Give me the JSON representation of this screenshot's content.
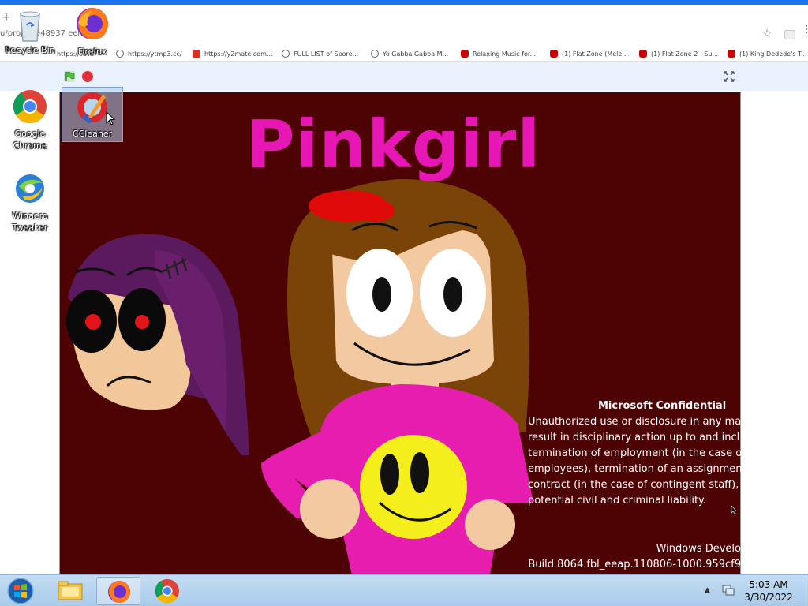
{
  "browser": {
    "new_tab_glyph": "+",
    "url": "u/proj  53948937  een/",
    "bookmarks": [
      {
        "label": "https://sav...",
        "icon": "globe-icon"
      },
      {
        "label": "https://ytmp3.cc/",
        "icon": "globe-icon"
      },
      {
        "label": "https://y2mate.com...",
        "icon": "red-favicon"
      },
      {
        "label": "FULL LIST of Spore...",
        "icon": "globe-icon"
      },
      {
        "label": "Yo Gabba Gabba M...",
        "icon": "globe-icon"
      },
      {
        "label": "Relaxing Music for...",
        "icon": "youtube-icon"
      },
      {
        "label": "(1) Flat Zone (Mele...",
        "icon": "youtube-icon"
      },
      {
        "label": "(1) Flat Zone 2 - Su...",
        "icon": "youtube-icon"
      },
      {
        "label": "(1) King Dedede's T...",
        "icon": "youtube-icon"
      }
    ]
  },
  "stage": {
    "title": "Pinkgirl"
  },
  "desktop_icons": [
    {
      "label": "Recycle Bin",
      "icon": "recycle-bin-icon"
    },
    {
      "label": "Firefox",
      "icon": "firefox-icon"
    },
    {
      "label": "Google Chrome",
      "icon": "chrome-icon"
    },
    {
      "label": "CCleaner",
      "icon": "ccleaner-icon"
    },
    {
      "label": "Winaero Tweaker",
      "icon": "winaero-icon"
    }
  ],
  "watermark": {
    "title": "Microsoft Confidential",
    "lines": [
      "Unauthorized use or disclosure in any ma",
      "result in disciplinary action up to and incl",
      "termination of employment (in the case o",
      "employees), termination of an assignmen",
      "contract (in the case of contingent staff),",
      "potential civil and criminal liability."
    ],
    "os_name": "Windows Develo",
    "build": "Build 8064.fbl_eeap.110806-1000.959cf9"
  },
  "taskbar": {
    "time": "5:03 AM",
    "date": "3/30/2022",
    "apps": [
      "explorer",
      "firefox",
      "chrome"
    ]
  },
  "colors": {
    "stage_bg": "#4d0303",
    "title_pink": "#e617b4",
    "taskbar": "#b7d4ef"
  }
}
